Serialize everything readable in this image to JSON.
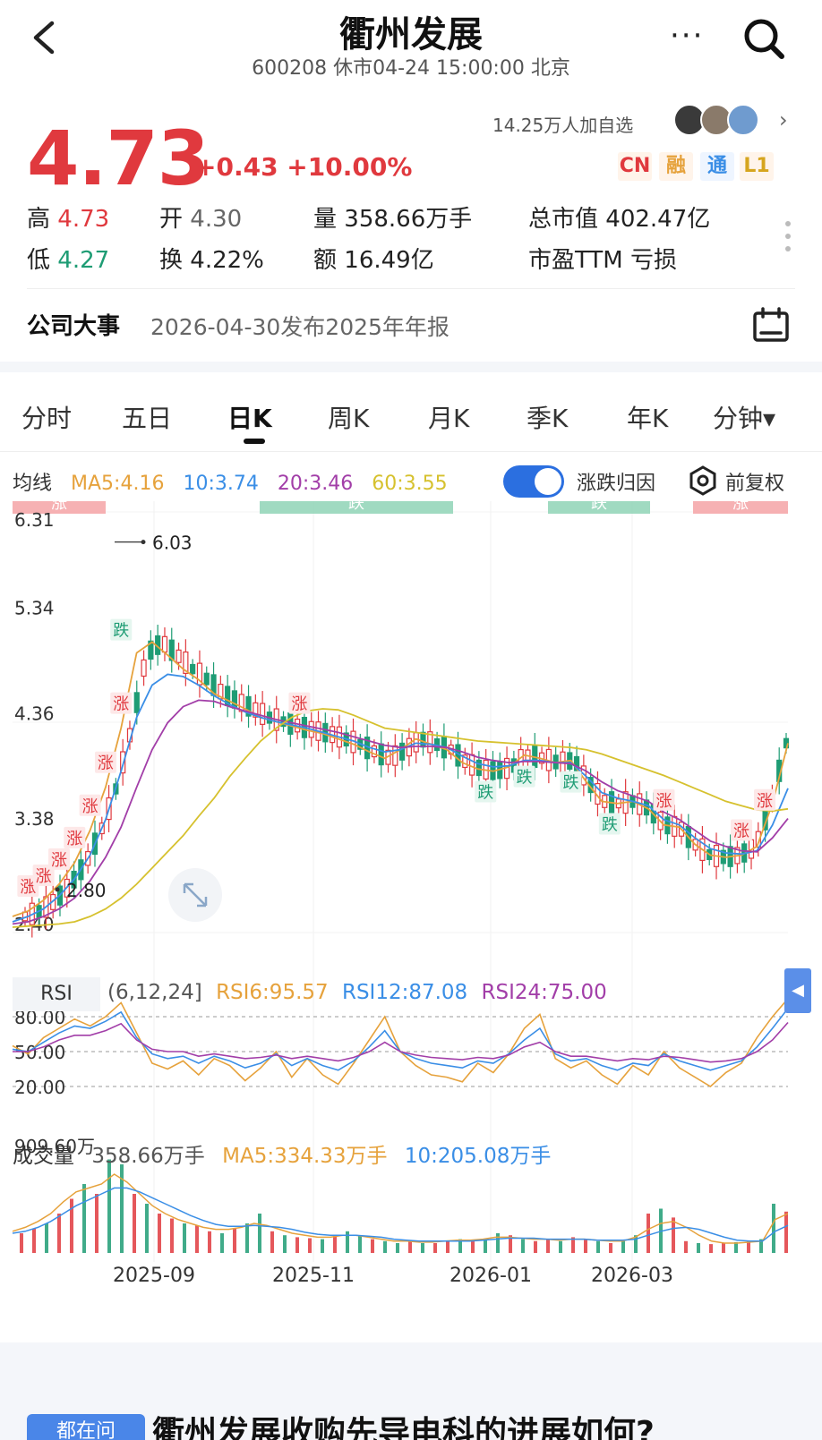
{
  "header": {
    "title": "衢州发展",
    "subtitle": "600208 休市04-24 15:00:00 北京",
    "more_label": "···"
  },
  "watch": {
    "text": "14.25万人加自选",
    "chevron": "›"
  },
  "quote": {
    "price": "4.73",
    "change": "+0.43 +10.00%",
    "badges": [
      "CN",
      "融",
      "通",
      "L1"
    ],
    "high_label": "高",
    "high": "4.73",
    "low_label": "低",
    "low": "4.27",
    "open_label": "开",
    "open": "4.30",
    "turnover_label": "换",
    "turnover": "4.22%",
    "volume_label": "量",
    "volume": "358.66万手",
    "amount_label": "额",
    "amount": "16.49亿",
    "mktcap_label": "总市值",
    "mktcap": "402.47亿",
    "pe_label": "市盈TTM",
    "pe": "亏损"
  },
  "event": {
    "label": "公司大事",
    "text": "2026-04-30发布2025年年报"
  },
  "tabs": [
    "分时",
    "五日",
    "日K",
    "周K",
    "月K",
    "季K",
    "年K",
    "分钟▾"
  ],
  "active_tab": 2,
  "ma": {
    "label": "均线",
    "ma5": "MA5:4.16",
    "ma10": "10:3.74",
    "ma20": "20:3.46",
    "ma60": "60:3.55",
    "toggle_label": "涨跌归因",
    "fq_label": "前复权"
  },
  "rsi": {
    "tag": "RSI",
    "params": "(6,12,24]",
    "rsi6": "RSI6:95.57",
    "rsi12": "RSI12:87.08",
    "rsi24": "RSI24:75.00",
    "side": "◀"
  },
  "volume": {
    "label": "成交量",
    "value": "358.66万手",
    "ma5": "MA5:334.33万手",
    "ma10": "10:205.08万手"
  },
  "colors": {
    "up": "#e0393e",
    "down": "#1e9c74",
    "ma5": "#e6a23c",
    "ma10": "#3a8ee6",
    "ma20": "#a23ea8",
    "ma60": "#d6c12e"
  },
  "chart_data": {
    "type": "candlestick",
    "price_axis": {
      "ticks": [
        "6.31",
        "5.34",
        "4.36",
        "3.38",
        "2.40"
      ],
      "ylim": [
        2.4,
        6.31
      ]
    },
    "x_ticks": [
      "2025-09",
      "2025-11",
      "2026-01",
      "2026-03"
    ],
    "max_label": "6.03",
    "min_label": "2.80",
    "attribution_bands": [
      "涨",
      "跌",
      "跌",
      "涨"
    ],
    "markers": [
      "涨",
      "涨",
      "涨",
      "涨",
      "涨",
      "涨",
      "涨",
      "跌",
      "涨",
      "跌",
      "跌",
      "跌",
      "跌",
      "涨",
      "涨",
      "涨"
    ],
    "ma_series": [
      {
        "name": "MA5",
        "points": [
          2.55,
          2.6,
          2.7,
          2.85,
          3.05,
          3.35,
          3.75,
          4.3,
          5.0,
          5.1,
          4.98,
          4.85,
          4.75,
          4.62,
          4.55,
          4.48,
          4.4,
          4.36,
          4.32,
          4.28,
          4.25,
          4.2,
          4.15,
          4.08,
          4.02,
          4.1,
          4.2,
          4.15,
          4.1,
          3.98,
          3.92,
          3.9,
          3.94,
          4.05,
          4.02,
          3.98,
          4.0,
          3.8,
          3.62,
          3.6,
          3.62,
          3.55,
          3.4,
          3.38,
          3.22,
          3.12,
          3.1,
          3.12,
          3.2,
          3.6,
          4.16
        ]
      },
      {
        "name": "10",
        "points": [
          2.5,
          2.55,
          2.62,
          2.74,
          2.9,
          3.12,
          3.45,
          3.9,
          4.4,
          4.7,
          4.8,
          4.78,
          4.7,
          4.6,
          4.52,
          4.45,
          4.4,
          4.36,
          4.33,
          4.3,
          4.26,
          4.22,
          4.18,
          4.12,
          4.08,
          4.1,
          4.16,
          4.15,
          4.12,
          4.04,
          3.97,
          3.94,
          3.95,
          4.0,
          4.0,
          3.98,
          3.98,
          3.85,
          3.7,
          3.65,
          3.62,
          3.58,
          3.45,
          3.4,
          3.28,
          3.18,
          3.14,
          3.13,
          3.16,
          3.4,
          3.74
        ]
      },
      {
        "name": "20",
        "points": [
          2.48,
          2.5,
          2.55,
          2.62,
          2.72,
          2.88,
          3.1,
          3.38,
          3.75,
          4.1,
          4.35,
          4.5,
          4.56,
          4.55,
          4.5,
          4.46,
          4.42,
          4.38,
          4.35,
          4.32,
          4.29,
          4.26,
          4.22,
          4.18,
          4.14,
          4.12,
          4.13,
          4.13,
          4.12,
          4.08,
          4.03,
          4.0,
          3.98,
          3.99,
          3.99,
          3.98,
          3.97,
          3.9,
          3.8,
          3.72,
          3.67,
          3.62,
          3.52,
          3.45,
          3.35,
          3.25,
          3.2,
          3.16,
          3.15,
          3.28,
          3.46
        ]
      },
      {
        "name": "60",
        "points": [
          2.45,
          2.46,
          2.47,
          2.48,
          2.5,
          2.55,
          2.62,
          2.72,
          2.85,
          3.0,
          3.15,
          3.3,
          3.48,
          3.65,
          3.85,
          4.02,
          4.18,
          4.3,
          4.4,
          4.46,
          4.48,
          4.47,
          4.42,
          4.36,
          4.3,
          4.28,
          4.26,
          4.24,
          4.22,
          4.2,
          4.18,
          4.17,
          4.16,
          4.15,
          4.14,
          4.13,
          4.12,
          4.1,
          4.06,
          4.01,
          3.96,
          3.91,
          3.86,
          3.8,
          3.74,
          3.68,
          3.62,
          3.58,
          3.54,
          3.53,
          3.55
        ]
      }
    ],
    "rsi_axis": {
      "ticks": [
        "80.00",
        "50.00",
        "20.00"
      ],
      "ylim": [
        0,
        100
      ]
    },
    "rsi_series": [
      {
        "name": "RSI6",
        "points": [
          55,
          48,
          62,
          70,
          78,
          72,
          80,
          92,
          66,
          40,
          35,
          42,
          30,
          44,
          38,
          25,
          36,
          50,
          28,
          44,
          30,
          22,
          40,
          60,
          80,
          50,
          38,
          30,
          28,
          24,
          40,
          32,
          48,
          70,
          82,
          44,
          36,
          42,
          30,
          22,
          38,
          30,
          50,
          36,
          28,
          20,
          32,
          40,
          62,
          80,
          95.57
        ]
      },
      {
        "name": "RSI12",
        "points": [
          52,
          50,
          58,
          66,
          72,
          70,
          76,
          84,
          62,
          48,
          44,
          46,
          40,
          46,
          42,
          36,
          40,
          48,
          38,
          44,
          38,
          34,
          42,
          54,
          68,
          50,
          44,
          40,
          38,
          36,
          42,
          40,
          48,
          60,
          70,
          48,
          42,
          44,
          38,
          34,
          40,
          38,
          48,
          42,
          38,
          34,
          38,
          42,
          54,
          70,
          87.08
        ]
      },
      {
        "name": "RSI24",
        "points": [
          50,
          50,
          54,
          60,
          64,
          64,
          68,
          74,
          60,
          52,
          50,
          50,
          46,
          48,
          46,
          44,
          45,
          47,
          44,
          46,
          44,
          42,
          45,
          50,
          58,
          50,
          47,
          45,
          44,
          43,
          45,
          44,
          47,
          54,
          58,
          50,
          46,
          46,
          44,
          42,
          44,
          43,
          46,
          45,
          43,
          41,
          42,
          44,
          50,
          60,
          75.0
        ]
      }
    ],
    "volume_axis": {
      "max_label": "909.60万"
    },
    "volume_bars": [
      20,
      25,
      30,
      40,
      55,
      70,
      60,
      95,
      90,
      60,
      50,
      40,
      35,
      30,
      28,
      22,
      20,
      25,
      30,
      40,
      22,
      18,
      16,
      15,
      14,
      18,
      22,
      18,
      14,
      12,
      10,
      12,
      10,
      10,
      12,
      14,
      12,
      14,
      20,
      18,
      14,
      12,
      14,
      12,
      16,
      14,
      12,
      10,
      12,
      18,
      40,
      45,
      36,
      12,
      10,
      9,
      10,
      11,
      12,
      14,
      50,
      42
    ],
    "volume_ma": [
      {
        "name": "MA5",
        "points": [
          22,
          26,
          32,
          40,
          52,
          62,
          66,
          70,
          80,
          72,
          60,
          48,
          40,
          34,
          30,
          26,
          24,
          24,
          26,
          30,
          28,
          24,
          20,
          18,
          16,
          16,
          18,
          18,
          16,
          14,
          12,
          12,
          11,
          11,
          12,
          13,
          13,
          14,
          16,
          16,
          15,
          14,
          14,
          13,
          14,
          14,
          13,
          12,
          12,
          16,
          24,
          30,
          32,
          26,
          18,
          12,
          10,
          10,
          11,
          12,
          34,
          40
        ]
      },
      {
        "name": "10",
        "points": [
          20,
          22,
          26,
          32,
          40,
          48,
          54,
          60,
          66,
          66,
          62,
          56,
          50,
          44,
          38,
          33,
          29,
          27,
          27,
          28,
          27,
          26,
          24,
          21,
          19,
          18,
          18,
          18,
          17,
          16,
          14,
          13,
          12,
          12,
          12,
          12,
          12,
          13,
          14,
          15,
          15,
          15,
          14,
          14,
          14,
          14,
          13,
          13,
          13,
          14,
          18,
          22,
          25,
          26,
          24,
          20,
          16,
          13,
          12,
          12,
          22,
          28
        ]
      }
    ]
  },
  "question": {
    "tag": "都在问",
    "text": "衢州发展收购先导电科的进展如何?"
  }
}
